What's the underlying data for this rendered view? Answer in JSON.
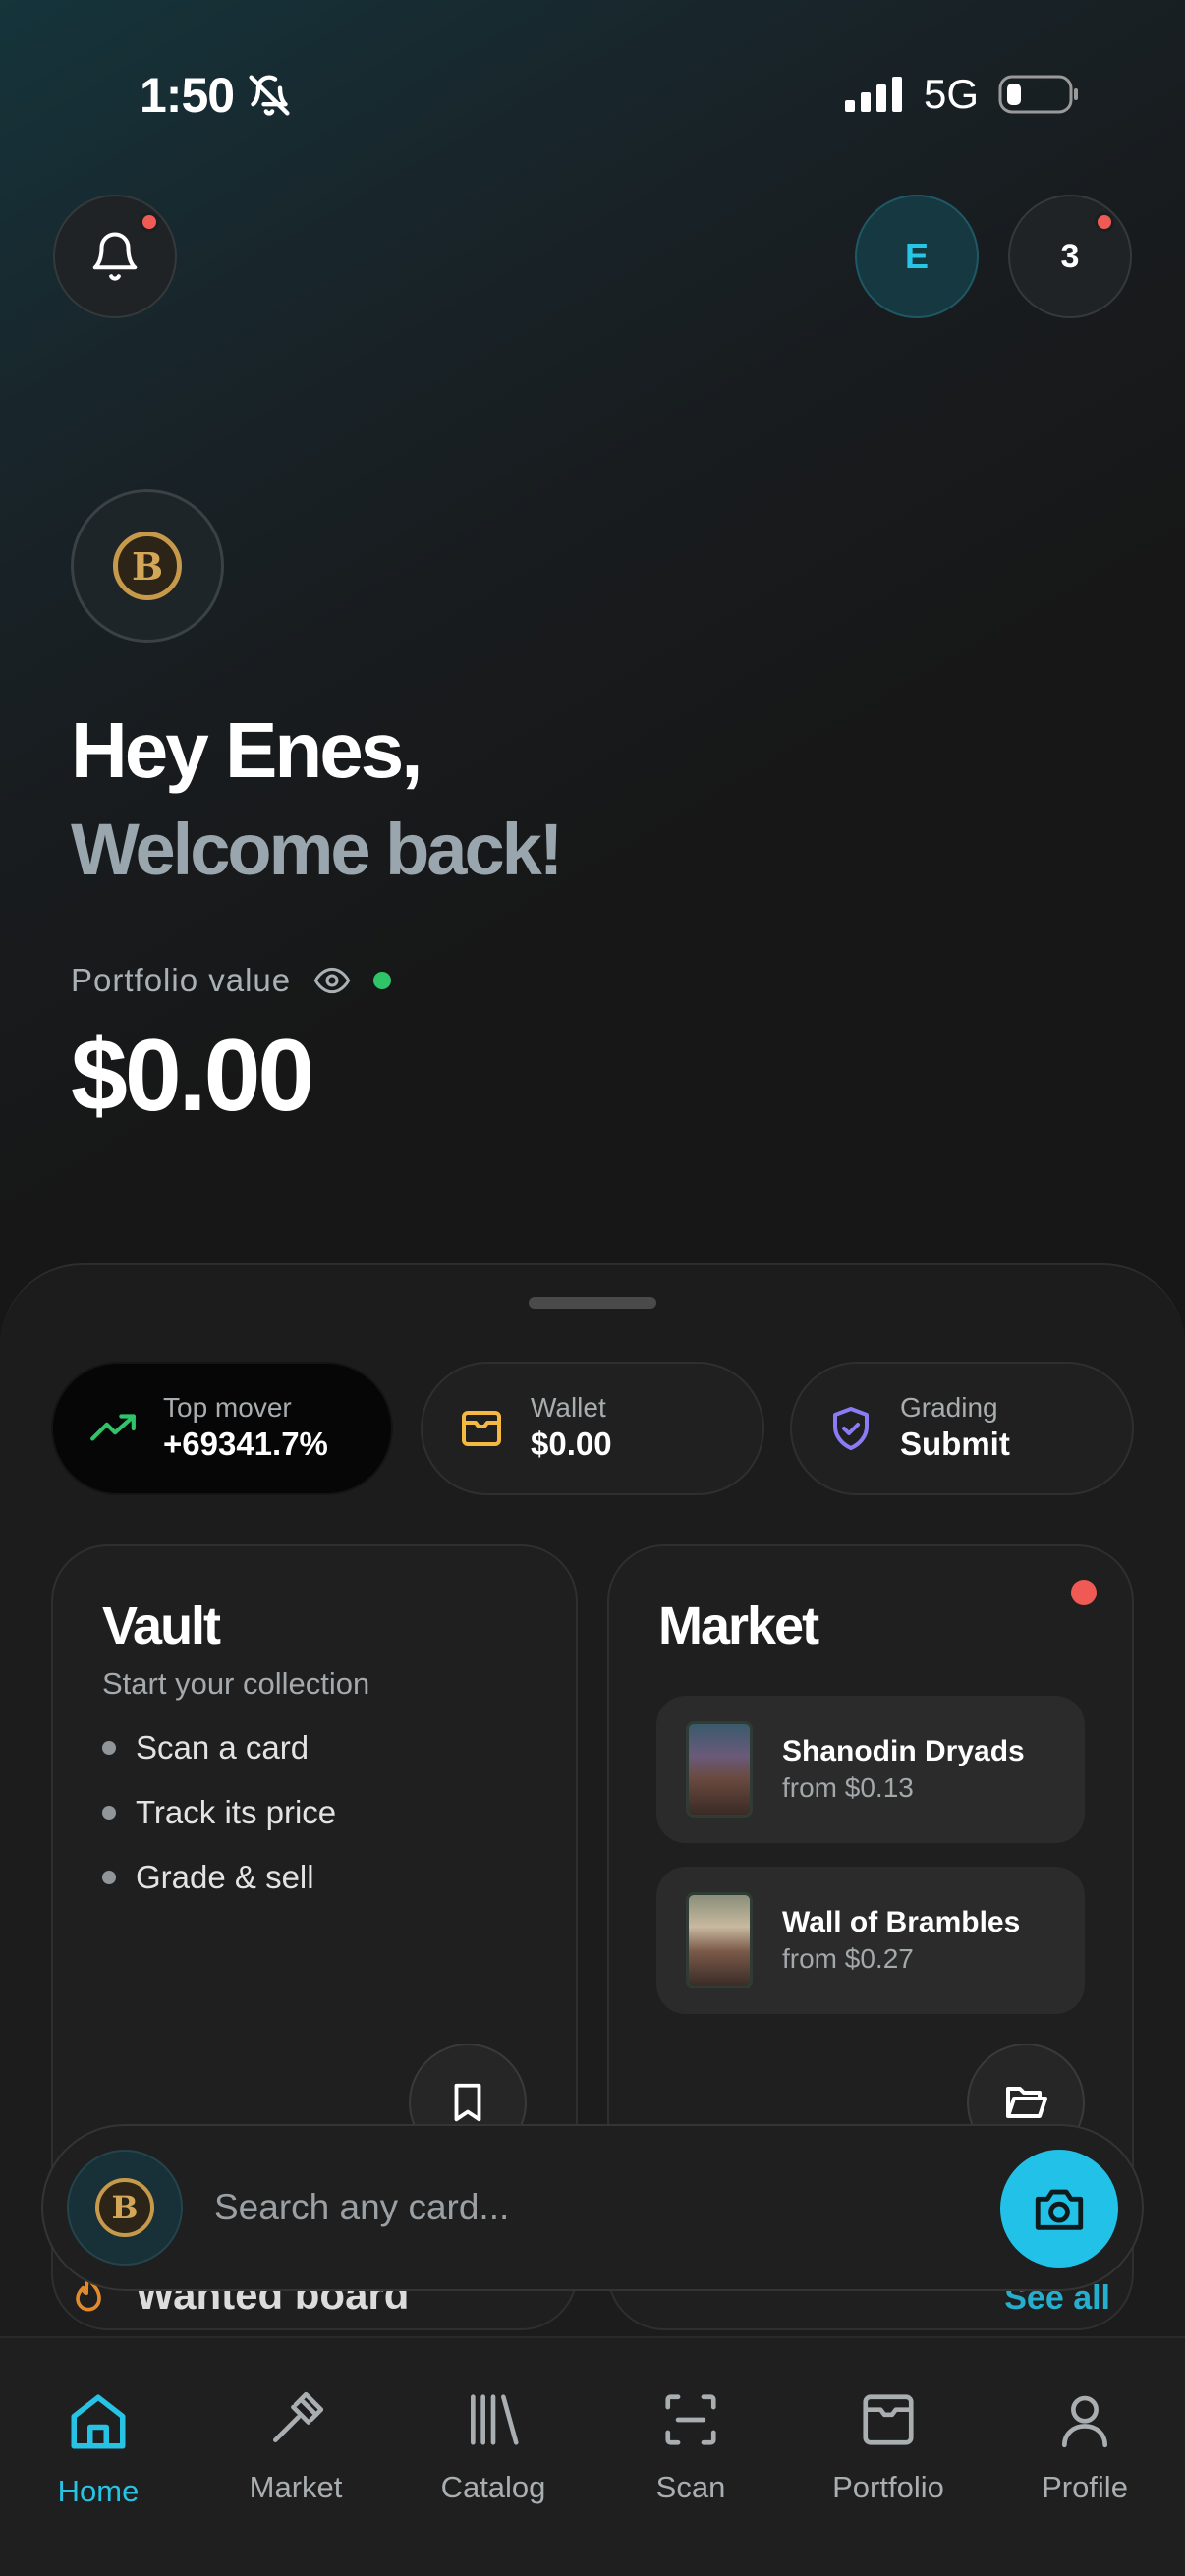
{
  "status_bar": {
    "time": "1:50",
    "network": "5G"
  },
  "header": {
    "avatar_initial": "E",
    "badge_count": "3"
  },
  "greeting": {
    "line1": "Hey Enes,",
    "line2": "Welcome back!"
  },
  "portfolio": {
    "label": "Portfolio value",
    "value": "$0.00"
  },
  "pills": [
    {
      "label": "Top mover",
      "value": "+69341.7%"
    },
    {
      "label": "Wallet",
      "value": "$0.00"
    },
    {
      "label": "Grading",
      "value": "Submit"
    }
  ],
  "vault": {
    "title": "Vault",
    "subtitle": "Start your collection",
    "steps": [
      "Scan a card",
      "Track its price",
      "Grade & sell"
    ]
  },
  "market": {
    "title": "Market",
    "items": [
      {
        "name": "Shanodin Dryads",
        "price": "from $0.13"
      },
      {
        "name": "Wall of Brambles",
        "price": "from $0.27"
      }
    ]
  },
  "wanted": {
    "title": "Wanted board",
    "see_all": "See all"
  },
  "search": {
    "placeholder": "Search any card..."
  },
  "coin_letter": "B",
  "tabs": [
    {
      "label": "Home",
      "icon": "home-icon",
      "active": true
    },
    {
      "label": "Market",
      "icon": "gavel-icon",
      "active": false
    },
    {
      "label": "Catalog",
      "icon": "library-icon",
      "active": false
    },
    {
      "label": "Scan",
      "icon": "scan-icon",
      "active": false
    },
    {
      "label": "Portfolio",
      "icon": "inbox-icon",
      "active": false
    },
    {
      "label": "Profile",
      "icon": "user-icon",
      "active": false
    }
  ],
  "colors": {
    "accent": "#22c2e8",
    "alert": "#f05a55",
    "live": "#2fc46a",
    "gain": "#2fc46a",
    "wallet": "#f5b942",
    "grading": "#8b7cf6"
  }
}
